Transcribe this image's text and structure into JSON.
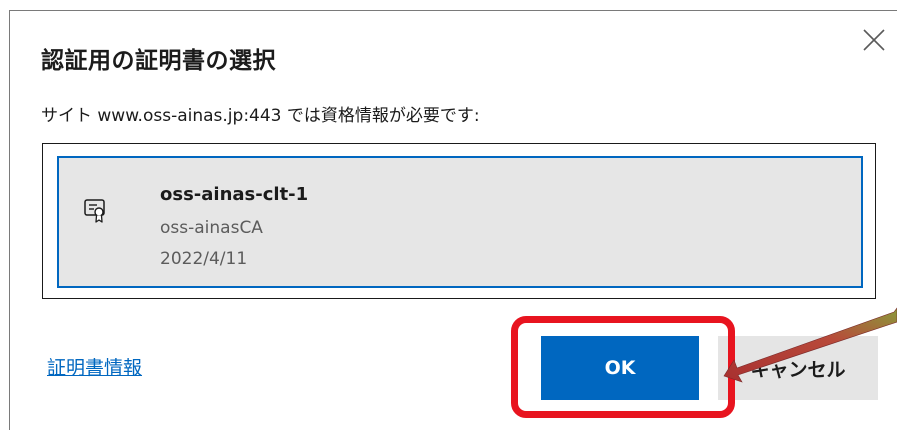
{
  "dialog": {
    "title": "認証用の証明書の選択",
    "subtitle": "サイト www.oss-ainas.jp:443 では資格情報が必要です:",
    "close_icon": "close-icon"
  },
  "certificates": [
    {
      "name": "oss-ainas-clt-1",
      "issuer": "oss-ainasCA",
      "date": "2022/4/11",
      "icon": "certificate-icon",
      "selected": true
    }
  ],
  "footer": {
    "cert_info_link": "証明書情報",
    "ok_label": "OK",
    "cancel_label": "キャンセル"
  },
  "annotation": {
    "highlight_color": "#e8141f",
    "arrow_color": "#b83a3a"
  },
  "colors": {
    "accent": "#0067c0",
    "selected_bg": "#e6e6e6",
    "secondary_text": "#5c5c5c"
  }
}
